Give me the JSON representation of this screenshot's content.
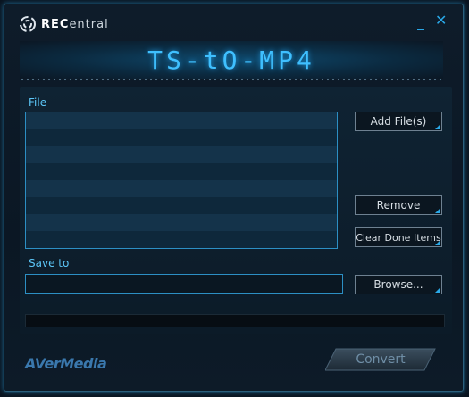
{
  "header": {
    "brand_prefix": "REC",
    "brand_suffix": "entral",
    "minimize_glyph": "_",
    "close_glyph": "✕",
    "app_title": "TS-tO-MP4"
  },
  "file_section": {
    "label": "File",
    "add_files_label": "Add File(s)",
    "remove_label": "Remove",
    "clear_done_label": "Clear Done Items"
  },
  "save_section": {
    "label": "Save to",
    "path_value": "",
    "browse_label": "Browse..."
  },
  "progress": {
    "fraction": 0
  },
  "footer": {
    "logo_text": "AVerMedia",
    "convert_label": "Convert"
  },
  "colors": {
    "accent": "#2aa9e8",
    "title_glow": "#3fc0ff",
    "label": "#5cc6f7",
    "background": "#0b1724"
  },
  "icons": {
    "brand": "recentral-swirl-icon",
    "minimize": "minimize-icon",
    "close": "close-icon"
  }
}
